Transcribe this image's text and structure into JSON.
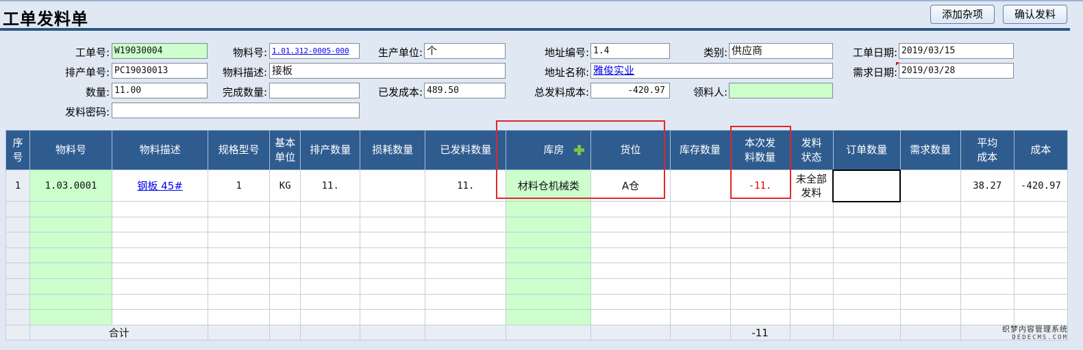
{
  "window": {
    "title": "工单发料单"
  },
  "toolbar": {
    "add_misc_label": "添加杂项",
    "confirm_label": "确认发料"
  },
  "form": {
    "work_order_no": {
      "label": "工单号:",
      "value": "W19030004"
    },
    "material_no": {
      "label": "物料号:",
      "value": "1.01.312-0005-000"
    },
    "production_unit": {
      "label": "生产单位:",
      "value": "个"
    },
    "address_code": {
      "label": "地址编号:",
      "value": "1.4"
    },
    "category": {
      "label": "类别:",
      "value": "供应商"
    },
    "work_order_date": {
      "label": "工单日期:",
      "value": "2019/03/15"
    },
    "schedule_no": {
      "label": "排产单号:",
      "value": "PC19030013"
    },
    "material_desc": {
      "label": "物料描述:",
      "value": "接板"
    },
    "address_name": {
      "label": "地址名称:",
      "value": "雅俊实业"
    },
    "demand_date": {
      "label": "需求日期:",
      "value": "2019/03/28"
    },
    "quantity": {
      "label": "数量:",
      "value": "11.00"
    },
    "completed_qty": {
      "label": "完成数量:",
      "value": ""
    },
    "issued_cost": {
      "label": "已发成本:",
      "value": "489.50"
    },
    "total_issue_cost": {
      "label": "总发料成本:",
      "value": "-420.97"
    },
    "receiver": {
      "label": "领料人:",
      "value": ""
    },
    "issue_password": {
      "label": "发料密码:",
      "value": ""
    }
  },
  "grid": {
    "headers": {
      "seq": "序\n号",
      "material_no": "物料号",
      "material_desc": "物料描述",
      "spec": "规格型号",
      "base_unit": "基本\n单位",
      "schedule_qty": "排产数量",
      "loss_qty": "损耗数量",
      "issued_qty": "已发料数量",
      "warehouse": "库房",
      "location": "货位",
      "stock_qty": "库存数量",
      "this_issue_qty": "本次发\n料数量",
      "issue_status": "发料\n状态",
      "order_qty": "订单数量",
      "demand_qty": "需求数量",
      "avg_cost": "平均\n成本",
      "cost": "成本"
    },
    "rows": [
      {
        "seq": "1",
        "material_no": "1.03.0001",
        "material_desc": "钢板 45#",
        "spec": "1",
        "base_unit": "KG",
        "schedule_qty": "11.",
        "loss_qty": "",
        "issued_qty": "11.",
        "warehouse": "材料仓机械类",
        "location": "A仓",
        "stock_qty": "",
        "this_issue_qty": "-11.",
        "issue_status": "未全部\n发料",
        "order_qty": "",
        "demand_qty": "",
        "avg_cost": "38.27",
        "cost": "-420.97"
      }
    ],
    "total": {
      "label": "合计",
      "this_issue_qty": "-11"
    }
  },
  "icons": {
    "warehouse_add": "plus-icon"
  },
  "colors": {
    "header_bg": "#2f5c8f",
    "editable_green": "#ccffcc",
    "highlight_red": "#e0252a",
    "negative_red": "#e00000"
  },
  "watermark": {
    "line1": "织梦内容管理系统",
    "line2": "DEDECMS.COM"
  }
}
